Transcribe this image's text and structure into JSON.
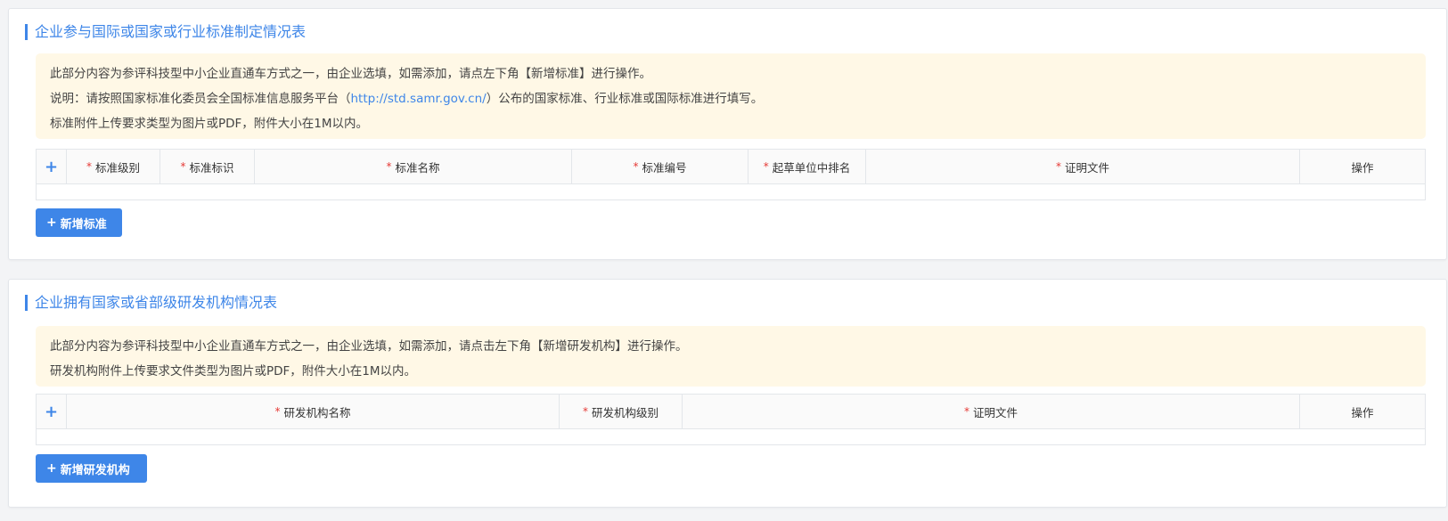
{
  "sections": [
    {
      "title": "企业参与国际或国家或行业标准制定情况表",
      "notice": {
        "line1": "此部分内容为参评科技型中小企业直通车方式之一，由企业选填，如需添加，请点左下角【新增标准】进行操作。",
        "line2_prefix": "说明：请按照国家标准化委员会全国标准信息服务平台（",
        "line2_link": "http://std.samr.gov.cn/",
        "line2_suffix": "）公布的国家标准、行业标准或国际标准进行填写。",
        "line3": "标准附件上传要求类型为图片或PDF，附件大小在1M以内。"
      },
      "table": {
        "add_icon": "+",
        "columns": [
          "标准级别",
          "标准标识",
          "标准名称",
          "标准编号",
          "起草单位中排名",
          "证明文件",
          "操作"
        ]
      },
      "button": {
        "icon": "+",
        "label": "新增标准"
      }
    },
    {
      "title": "企业拥有国家或省部级研发机构情况表",
      "notice": {
        "line1": "此部分内容为参评科技型中小企业直通车方式之一，由企业选填，如需添加，请点击左下角【新增研发机构】进行操作。",
        "line2": "研发机构附件上传要求文件类型为图片或PDF，附件大小在1M以内。"
      },
      "table": {
        "add_icon": "+",
        "columns": [
          "研发机构名称",
          "研发机构级别",
          "证明文件",
          "操作"
        ]
      },
      "button": {
        "icon": "+",
        "label": "新增研发机构"
      }
    }
  ],
  "required_mark": "*",
  "colors": {
    "accent": "#3e86e8",
    "notice_bg": "#fff8e6",
    "required": "#e53935"
  }
}
